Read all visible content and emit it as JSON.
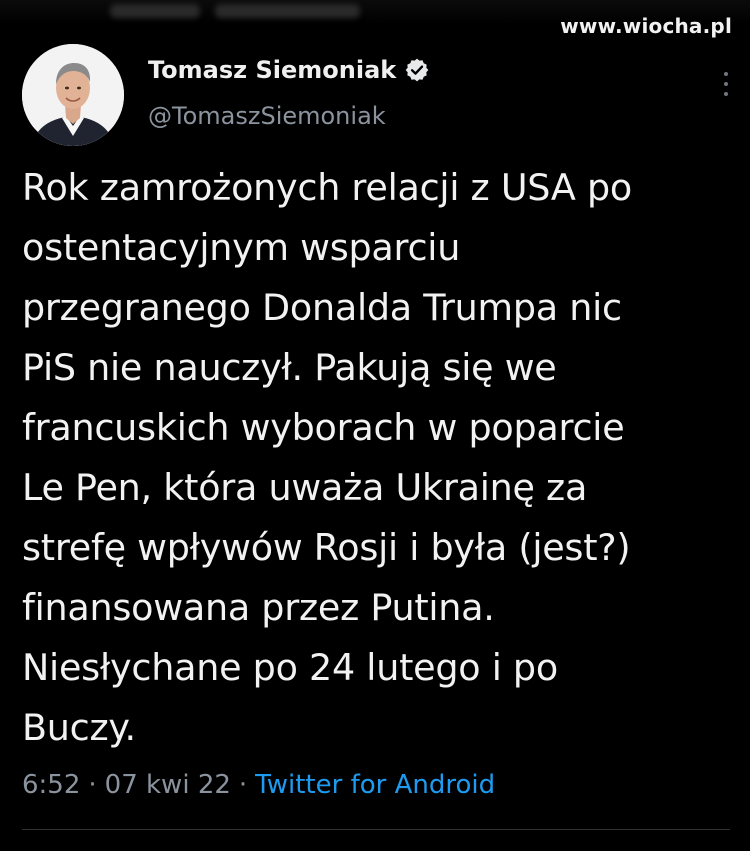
{
  "watermark": "www.wiocha.pl",
  "tweet": {
    "display_name": "Tomasz Siemoniak",
    "handle": "@TomaszSiemoniak",
    "verified": true,
    "text": "Rok zamrożonych relacji z USA po\nostentacyjnym wsparciu\nprzegranego Donalda Trumpa nic\nPiS nie nauczył. Pakują się we\nfrancuskich wyborach w poparcie\nLe Pen, która uważa Ukrainę za\nstrefę wpływów Rosji i była (jest?)\nfinansowana przez Putina.\nNiesłychane po 24 lutego i po\nBuczy.",
    "time": "6:52",
    "date": "07 kwi 22",
    "source": "Twitter for Android",
    "separator": "·"
  },
  "colors": {
    "background": "#000000",
    "text": "#f2f2f2",
    "muted": "#8b949e",
    "link": "#1d9bf0",
    "verified_badge": "#e7e9ea"
  },
  "icons": {
    "verified": "verified-badge-icon",
    "more": "more-vertical-icon",
    "avatar": "profile-photo"
  }
}
